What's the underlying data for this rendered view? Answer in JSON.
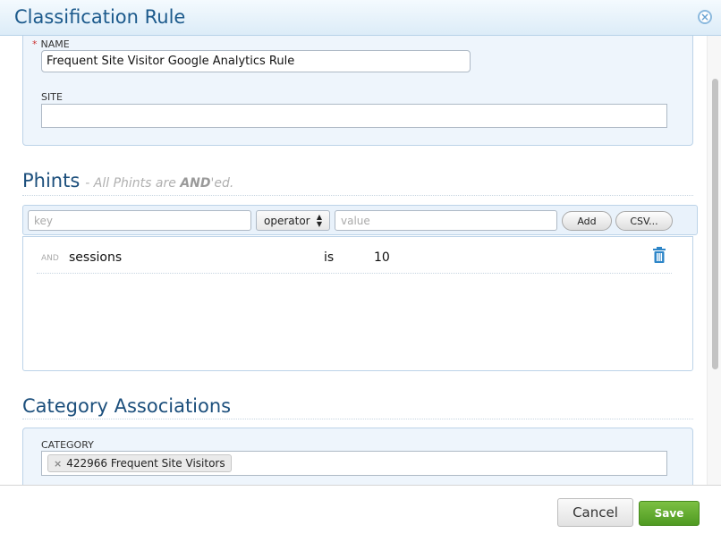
{
  "dialog": {
    "title": "Classification Rule"
  },
  "form": {
    "name_label": "NAME",
    "name_required_marker": "*",
    "name_value": "Frequent Site Visitor Google Analytics Rule",
    "site_label": "SITE",
    "site_value": ""
  },
  "phints": {
    "title": "Phints",
    "hint_prefix": "- All Phints are ",
    "hint_bold": "AND",
    "hint_suffix": "'ed.",
    "key_placeholder": "key",
    "operator_label": "operator",
    "value_placeholder": "value",
    "add_label": "Add",
    "csv_label": "CSV...",
    "rows": [
      {
        "conj": "AND",
        "key": "sessions",
        "op": "is",
        "value": "10"
      }
    ]
  },
  "categories": {
    "title": "Category Associations",
    "label": "CATEGORY",
    "tags": [
      {
        "remove": "×",
        "text": "422966 Frequent Site Visitors"
      }
    ]
  },
  "footer": {
    "cancel_label": "Cancel",
    "save_label": "Save"
  },
  "colors": {
    "accent": "#1c5a8c",
    "save": "#5aa52a"
  }
}
